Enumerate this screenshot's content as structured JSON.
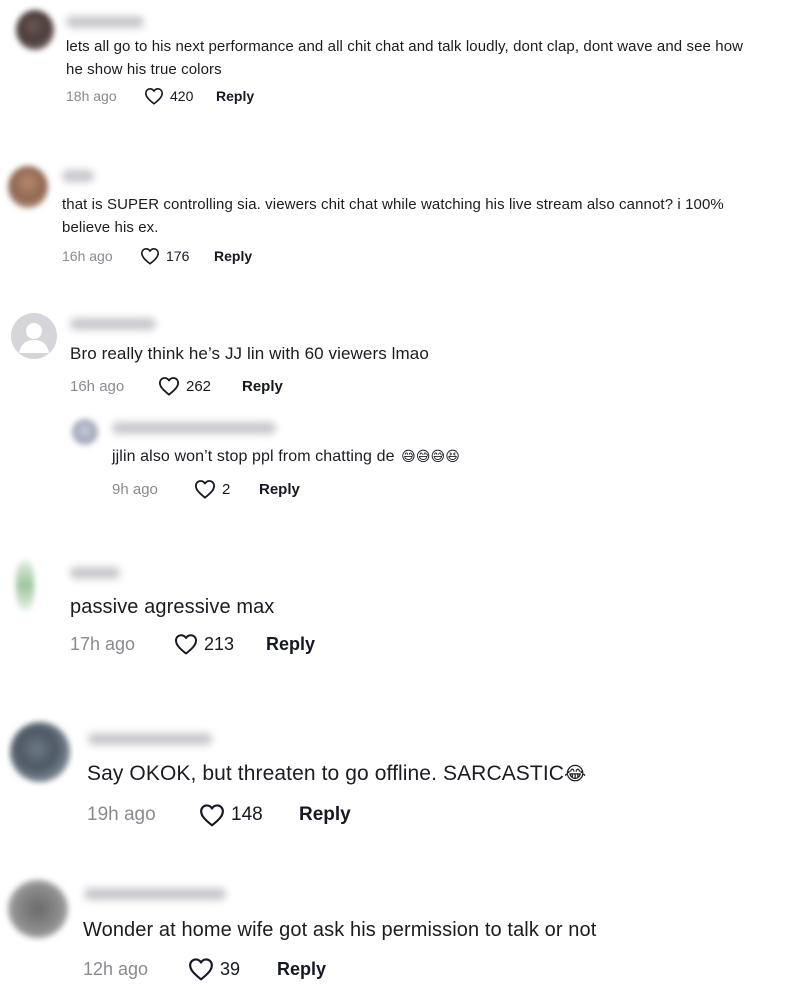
{
  "comments": [
    {
      "text_line1": "lets all go to his next performance and all chit chat and talk loudly, dont clap, dont wave and see how",
      "text_line2": "he show his true colors",
      "time": "18h ago",
      "likes": "420",
      "reply": "Reply"
    },
    {
      "text_line1": "that is SUPER controlling sia. viewers chit chat while watching his live stream also cannot? i 100%",
      "text_line2": "believe his ex.",
      "time": "16h ago",
      "likes": "176",
      "reply": "Reply"
    },
    {
      "text": "Bro really think he’s JJ lin with 60 viewers lmao",
      "time": "16h ago",
      "likes": "262",
      "reply": "Reply"
    },
    {
      "text": "jjlin also won’t stop ppl from chatting de",
      "emoji": "😅😅😅😆",
      "time": "9h ago",
      "likes": "2",
      "reply": "Reply"
    },
    {
      "text": "passive agressive max",
      "time": "17h ago",
      "likes": "213",
      "reply": "Reply"
    },
    {
      "text": "Say OKOK, but threaten to go offline. SARCASTIC",
      "emoji": "😂",
      "time": "19h ago",
      "likes": "148",
      "reply": "Reply"
    },
    {
      "text": "Wonder at home wife got ask his permission to talk or not",
      "time": "12h ago",
      "likes": "39",
      "reply": "Reply"
    }
  ]
}
